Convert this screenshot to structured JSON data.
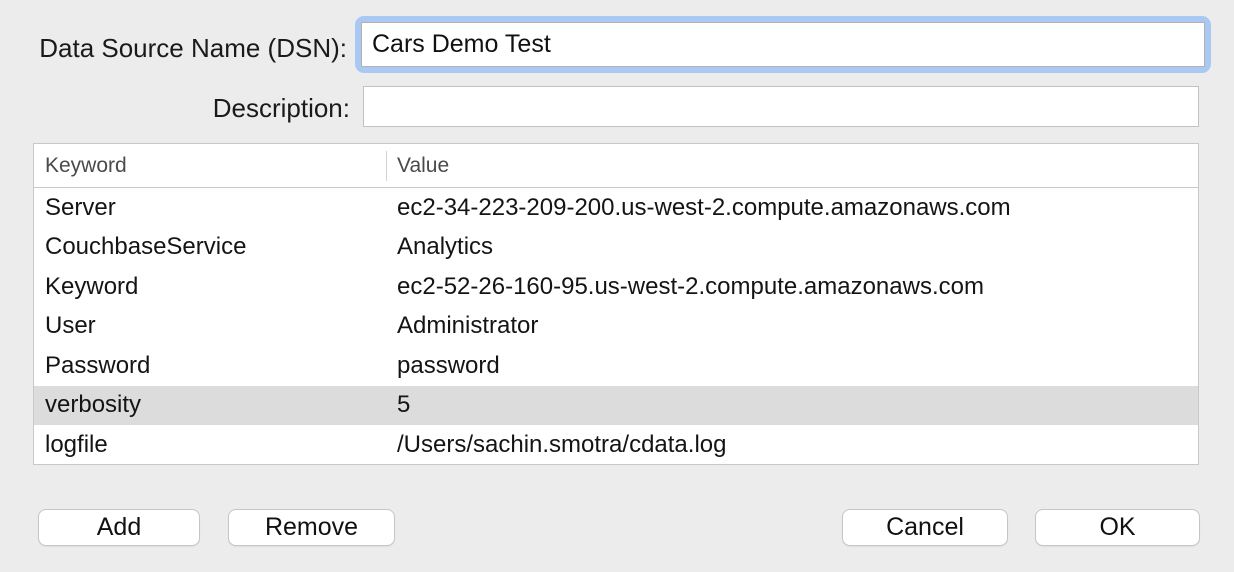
{
  "form": {
    "dsn_label": "Data Source Name (DSN):",
    "dsn_value": "Cars Demo Test",
    "description_label": "Description:",
    "description_value": ""
  },
  "table": {
    "columns": [
      "Keyword",
      "Value"
    ],
    "rows": [
      {
        "keyword": "Server",
        "value": "ec2-34-223-209-200.us-west-2.compute.amazonaws.com",
        "selected": false
      },
      {
        "keyword": "CouchbaseService",
        "value": "Analytics",
        "selected": false
      },
      {
        "keyword": "Keyword",
        "value": "ec2-52-26-160-95.us-west-2.compute.amazonaws.com",
        "selected": false
      },
      {
        "keyword": "User",
        "value": "Administrator",
        "selected": false
      },
      {
        "keyword": "Password",
        "value": "password",
        "selected": false
      },
      {
        "keyword": "verbosity",
        "value": "5",
        "selected": true
      },
      {
        "keyword": "logfile",
        "value": "/Users/sachin.smotra/cdata.log",
        "selected": false
      }
    ]
  },
  "buttons": {
    "add": "Add",
    "remove": "Remove",
    "cancel": "Cancel",
    "ok": "OK"
  },
  "colors": {
    "background": "#ececec",
    "focus_ring": "#a9c9f4",
    "selected_row": "#dcdcdc",
    "table_border": "#c9c9c9"
  }
}
